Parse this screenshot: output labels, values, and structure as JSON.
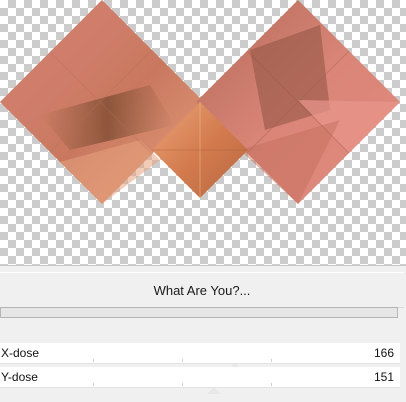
{
  "preview": {
    "image": "pink-bronze-double-diamond-pattern"
  },
  "filter": {
    "title": "What Are You?...",
    "progress": 0
  },
  "params": [
    {
      "label": "X-dose",
      "value": "166",
      "level": 0.65
    },
    {
      "label": "Y-dose",
      "value": "151",
      "level": 0.59
    }
  ],
  "colors": {
    "checker_light": "#ffffff",
    "checker_dark": "#cccccc",
    "tile_pink": "#d98072",
    "tile_salmon": "#e0907c",
    "tile_bronze": "#8a5a3c",
    "tile_orange": "#d2885e"
  }
}
